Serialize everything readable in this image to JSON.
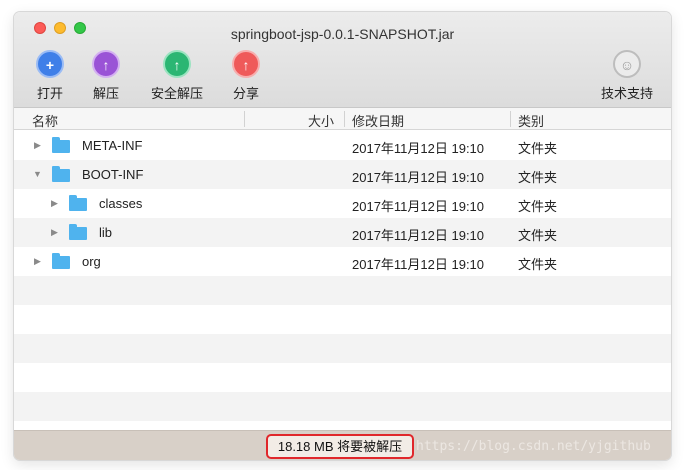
{
  "window": {
    "title": "springboot-jsp-0.0.1-SNAPSHOT.jar"
  },
  "toolbar": {
    "open_label": "打开",
    "extract_label": "解压",
    "safe_extract_label": "安全解压",
    "share_label": "分享",
    "support_label": "技术支持",
    "open_glyph": "+",
    "extract_glyph": "↑",
    "safe_glyph": "↑",
    "share_glyph": "↑",
    "support_glyph": "☺"
  },
  "columns": {
    "name": "名称",
    "size": "大小",
    "date": "修改日期",
    "kind": "类别"
  },
  "files": [
    {
      "name": "META-INF",
      "date": "2017年11月12日 19:10",
      "kind": "文件夹",
      "expanded": false
    },
    {
      "name": "BOOT-INF",
      "date": "2017年11月12日 19:10",
      "kind": "文件夹",
      "expanded": true
    },
    {
      "name": "classes",
      "date": "2017年11月12日 19:10",
      "kind": "文件夹",
      "expanded": false
    },
    {
      "name": "lib",
      "date": "2017年11月12日 19:10",
      "kind": "文件夹",
      "expanded": false
    },
    {
      "name": "org",
      "date": "2017年11月12日 19:10",
      "kind": "文件夹",
      "expanded": false
    }
  ],
  "status": {
    "text": "18.18 MB 将要被解压"
  },
  "watermark": "https://blog.csdn.net/yjgithub",
  "colors": {
    "folder": "#4fb3ee",
    "highlight_border": "#e0272b",
    "open_icon": "#3f7fe8",
    "extract_icon": "#9a53d6",
    "safe_icon": "#2bb673",
    "share_icon": "#ef5a5a"
  }
}
